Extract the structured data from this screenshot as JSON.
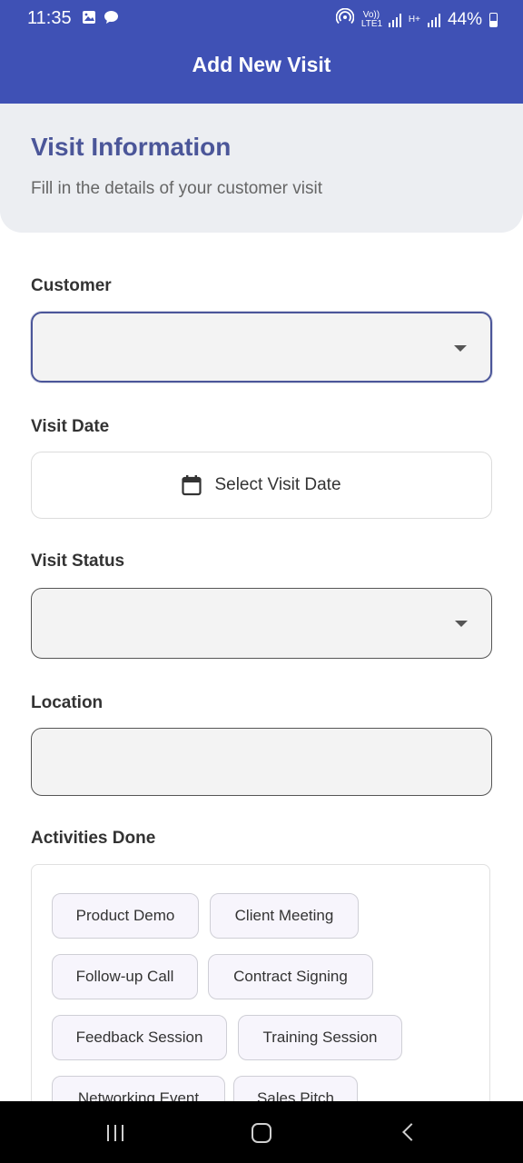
{
  "status_bar": {
    "time": "11:35",
    "network_1": "Vo)) LTE1",
    "network_2": "H+",
    "battery": "44%"
  },
  "app_bar": {
    "title": "Add New Visit"
  },
  "header": {
    "title": "Visit Information",
    "subtitle": "Fill in the details of your customer visit"
  },
  "form": {
    "customer_label": "Customer",
    "customer_value": "",
    "visit_date_label": "Visit Date",
    "visit_date_button": "Select Visit Date",
    "visit_status_label": "Visit Status",
    "visit_status_value": "",
    "location_label": "Location",
    "location_value": "",
    "activities_label": "Activities Done",
    "activities": [
      "Product Demo",
      "Client Meeting",
      "Follow-up Call",
      "Contract Signing",
      "Feedback Session",
      "Training Session",
      "Networking Event",
      "Sales Pitch"
    ]
  },
  "colors": {
    "app_bar": "#3f51b5",
    "accent": "#4b5699",
    "header_card": "#eceef2"
  },
  "icons": {
    "date_button": "calendar-icon",
    "dropdown": "dropdown-arrow-icon"
  }
}
